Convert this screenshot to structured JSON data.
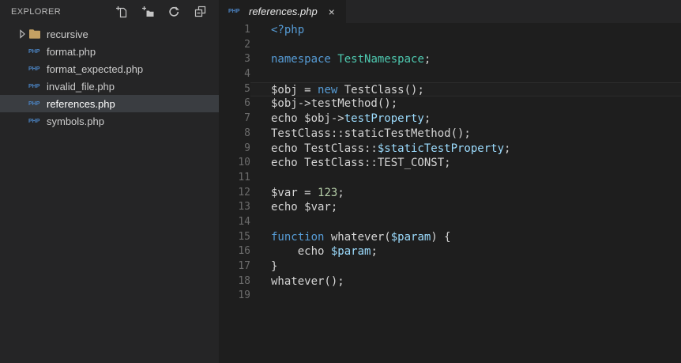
{
  "colors": {
    "editor_bg": "#1e1e1e",
    "sidebar_bg": "#252526",
    "selected_row_bg": "#3a3d41",
    "plain": "#d4d4d4",
    "keyword": "#569cd6",
    "class": "#4ec9b0",
    "property": "#9cdcfe",
    "number": "#b5cea8",
    "line_number": "#6b6b6b",
    "php_icon": "#4b84c4",
    "folder_icon": "#c5a163",
    "ui_icon": "#c5c5c5"
  },
  "icons": {
    "php_badge_text": "PHP"
  },
  "sidebar": {
    "title": "EXPLORER",
    "actions": [
      {
        "name": "new-file-icon"
      },
      {
        "name": "new-folder-icon"
      },
      {
        "name": "refresh-icon"
      },
      {
        "name": "collapse-all-icon"
      }
    ],
    "files": [
      {
        "label": "recursive",
        "kind": "folder",
        "expanded": false,
        "selected": false
      },
      {
        "label": "format.php",
        "kind": "php",
        "selected": false
      },
      {
        "label": "format_expected.php",
        "kind": "php",
        "selected": false
      },
      {
        "label": "invalid_file.php",
        "kind": "php",
        "selected": false
      },
      {
        "label": "references.php",
        "kind": "php",
        "selected": true
      },
      {
        "label": "symbols.php",
        "kind": "php",
        "selected": false
      }
    ]
  },
  "editor": {
    "tabs": [
      {
        "label": "references.php",
        "icon": "php",
        "close_glyph": "×",
        "active": true,
        "preview": true
      }
    ],
    "active_line": 5,
    "lines": [
      {
        "n": 1,
        "tokens": [
          [
            "<?php",
            "keyword"
          ]
        ]
      },
      {
        "n": 2,
        "tokens": []
      },
      {
        "n": 3,
        "tokens": [
          [
            "namespace",
            "keyword"
          ],
          [
            " ",
            "plain"
          ],
          [
            "TestNamespace",
            "class"
          ],
          [
            ";",
            "plain"
          ]
        ]
      },
      {
        "n": 4,
        "tokens": []
      },
      {
        "n": 5,
        "tokens": [
          [
            "$obj = ",
            "plain"
          ],
          [
            "new",
            "keyword"
          ],
          [
            " TestClass();",
            "plain"
          ]
        ]
      },
      {
        "n": 6,
        "tokens": [
          [
            "$obj->testMethod();",
            "plain"
          ]
        ]
      },
      {
        "n": 7,
        "tokens": [
          [
            "echo $obj->",
            "plain"
          ],
          [
            "testProperty",
            "property"
          ],
          [
            ";",
            "plain"
          ]
        ]
      },
      {
        "n": 8,
        "tokens": [
          [
            "TestClass::staticTestMethod();",
            "plain"
          ]
        ]
      },
      {
        "n": 9,
        "tokens": [
          [
            "echo TestClass::",
            "plain"
          ],
          [
            "$staticTestProperty",
            "property"
          ],
          [
            ";",
            "plain"
          ]
        ]
      },
      {
        "n": 10,
        "tokens": [
          [
            "echo TestClass::TEST_CONST;",
            "plain"
          ]
        ]
      },
      {
        "n": 11,
        "tokens": []
      },
      {
        "n": 12,
        "tokens": [
          [
            "$var = ",
            "plain"
          ],
          [
            "123",
            "number"
          ],
          [
            ";",
            "plain"
          ]
        ]
      },
      {
        "n": 13,
        "tokens": [
          [
            "echo $var;",
            "plain"
          ]
        ]
      },
      {
        "n": 14,
        "tokens": []
      },
      {
        "n": 15,
        "tokens": [
          [
            "function",
            "keyword"
          ],
          [
            " whatever(",
            "plain"
          ],
          [
            "$param",
            "property"
          ],
          [
            ") {",
            "plain"
          ]
        ]
      },
      {
        "n": 16,
        "tokens": [
          [
            "    echo ",
            "plain"
          ],
          [
            "$param",
            "property"
          ],
          [
            ";",
            "plain"
          ]
        ]
      },
      {
        "n": 17,
        "tokens": [
          [
            "}",
            "plain"
          ]
        ]
      },
      {
        "n": 18,
        "tokens": [
          [
            "whatever();",
            "plain"
          ]
        ]
      },
      {
        "n": 19,
        "tokens": []
      }
    ]
  }
}
